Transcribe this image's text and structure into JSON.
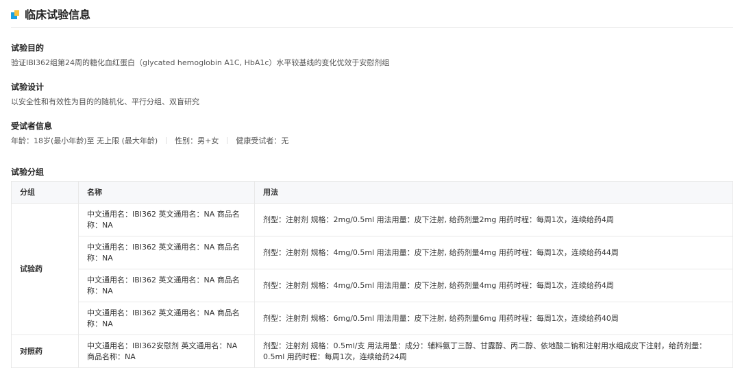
{
  "header": {
    "title": "临床试验信息"
  },
  "objective": {
    "label": "试验目的",
    "text": "验证IBI362组第24周的糖化血红蛋白（glycated hemoglobin A1C, HbA1c）水平较基线的变化优效于安慰剂组"
  },
  "design": {
    "label": "试验设计",
    "text": "以安全性和有效性为目的的随机化、平行分组、双盲研究"
  },
  "subjects": {
    "label": "受试者信息",
    "age": "年龄：18岁(最小年龄)至 无上限 (最大年龄)",
    "sex": "性别：男+女",
    "healthy": "健康受试者：无"
  },
  "arms": {
    "label": "试验分组",
    "columns": [
      "分组",
      "名称",
      "用法"
    ],
    "experimental_group": "试验药",
    "control_group": "对照药",
    "experimental_rows": [
      {
        "name": "中文通用名：IBI362 英文通用名：NA 商品名称：NA",
        "usage": "剂型：注射剂 规格：2mg/0.5ml 用法用量：皮下注射, 给药剂量2mg 用药时程：每周1次，连续给药4周"
      },
      {
        "name": "中文通用名：IBI362 英文通用名：NA 商品名称：NA",
        "usage": "剂型：注射剂 规格：4mg/0.5ml 用法用量：皮下注射, 给药剂量4mg 用药时程：每周1次，连续给药44周"
      },
      {
        "name": "中文通用名：IBI362 英文通用名：NA 商品名称：NA",
        "usage": "剂型：注射剂 规格：4mg/0.5ml 用法用量：皮下注射, 给药剂量4mg 用药时程：每周1次，连续给药4周"
      },
      {
        "name": "中文通用名：IBI362 英文通用名：NA 商品名称：NA",
        "usage": "剂型：注射剂 规格：6mg/0.5ml 用法用量：皮下注射, 给药剂量6mg 用药时程：每周1次，连续给药40周"
      }
    ],
    "control_rows": [
      {
        "name": "中文通用名：IBI362安慰剂 英文通用名：NA 商品名称：NA",
        "usage": "剂型：注射剂 规格：0.5ml/支 用法用量：成分：辅料氨丁三醇、甘露醇、丙二醇、依地酸二钠和注射用水组成皮下注射，给药剂量：0.5ml 用药时程：每周1次，连续给药24周"
      }
    ]
  },
  "colors": {
    "icon_blue": "#1aa0e0",
    "icon_yellow": "#f7c23e",
    "header_bg": "#f7f8fa",
    "border": "#e8e8e8"
  }
}
